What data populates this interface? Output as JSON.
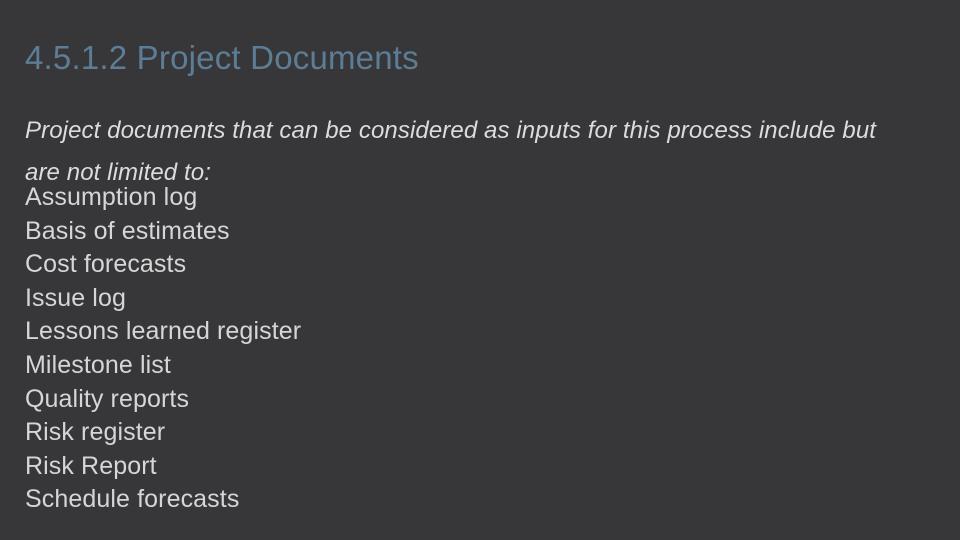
{
  "slide": {
    "title": "4.5.1.2 Project Documents",
    "subtitle": "Project documents that can be considered as inputs for this process include but are not limited to:",
    "documents": [
      "Assumption log",
      "Basis of estimates",
      "Cost forecasts",
      "Issue log",
      "Lessons learned register",
      "Milestone list",
      "Quality reports",
      "Risk register",
      "Risk Report",
      "Schedule forecasts"
    ]
  },
  "colors": {
    "background": "#373739",
    "title": "#5d7d96",
    "subtitle": "#dcdcdc",
    "body_text": "#d6d6d6"
  }
}
